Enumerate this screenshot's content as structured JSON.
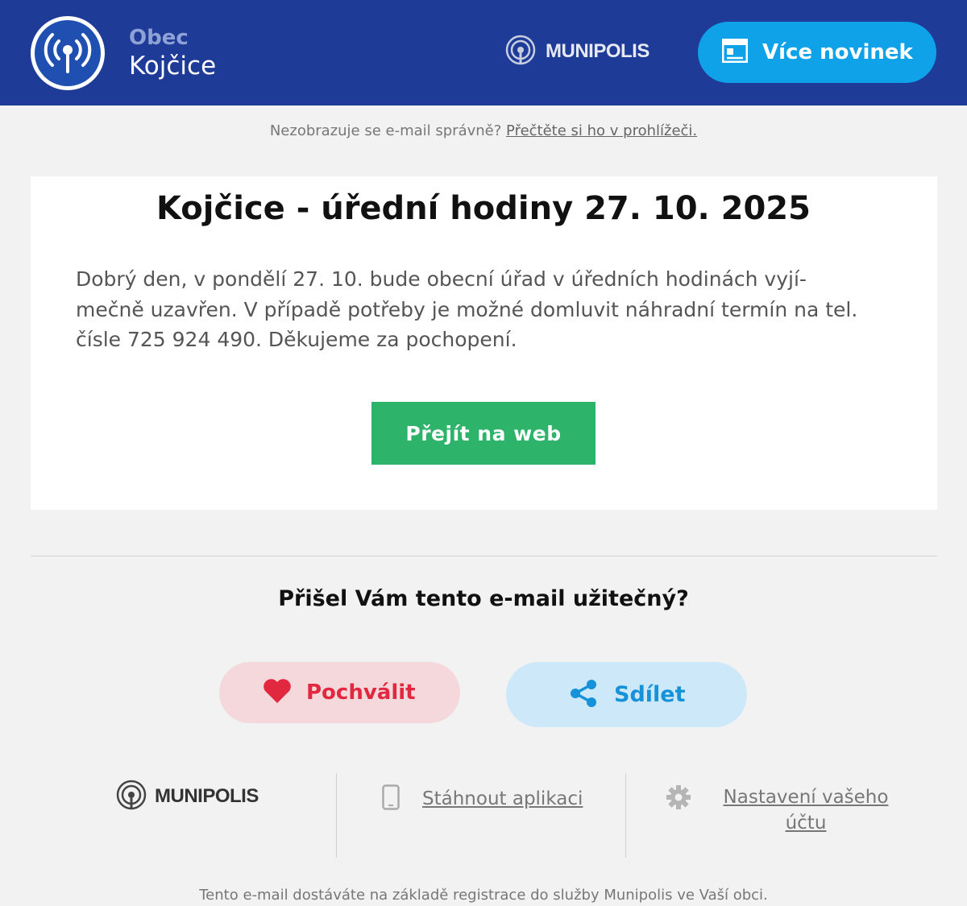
{
  "header": {
    "org_label": "Obec",
    "org_name": "Kojčice",
    "brand_name": "MUNIPOLIS",
    "more_news_label": "Více novinek",
    "background_color": "#1f3b98",
    "button_color": "#0fa2e8"
  },
  "notice": {
    "text": "Nezobrazuje se e-mail správně?",
    "link": "Přečtěte si ho v prohlížeči."
  },
  "article": {
    "title": "Kojčice - úřední hodiny 27. 10. 2025",
    "body": "Dobrý den, v pondělí 27. 10. bude obecní úřad v úředních hodinách vyjí-mečně uzavřen. V případě potřeby je možné domluvit náhradní termín na tel. čísle 725 924 490. Děkujeme za pochopení.",
    "cta_label": "Přejít na web",
    "cta_color": "#2eb36a"
  },
  "feedback": {
    "question": "Přišel Vám tento e-mail užitečný?",
    "praise_label": "Pochválit",
    "share_label": "Sdílet",
    "praise_color": "#e2283e",
    "share_color": "#1592d9"
  },
  "footer": {
    "brand_name": "MUNIPOLIS",
    "download_app": "Stáhnout aplikaci",
    "account_settings": "Nastavení vašeho účtu",
    "registration_note": "Tento e-mail dostáváte na základě registrace do služby Munipolis ve Vaší obci."
  },
  "icons": [
    "broadcast-tower-icon",
    "munipolis-logo-icon",
    "newspaper-icon",
    "heart-icon",
    "share-icon",
    "smartphone-icon",
    "gear-icon"
  ]
}
